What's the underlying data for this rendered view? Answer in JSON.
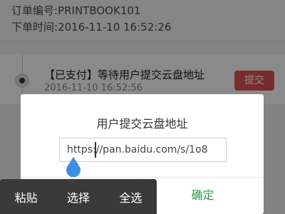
{
  "order": {
    "number_label": "订单编号:",
    "number": "PRINTBOOK101",
    "time_label": "下单时间:",
    "time": "2016-11-10 16:52:26"
  },
  "timeline": {
    "status_title": "【已支付】等待用户提交云盘地址",
    "status_time": "2016-11-10 16:52:56",
    "submit_label": "提交"
  },
  "dialog": {
    "title": "用户提交云盘地址",
    "input_value": "https://pan.baidu.com/s/1o8",
    "confirm_label": "确定"
  },
  "selection_toolbar": {
    "paste": "粘贴",
    "select": "选择",
    "select_all": "全选"
  },
  "colors": {
    "submit_button": "#d9534f",
    "confirm_text": "#2e9a3e",
    "cursor_handle": "#3d8fe0",
    "toolbar_bg": "#3a3a3a"
  },
  "icons": {
    "timeline_dot": "timeline-dot-icon",
    "text_handle": "text-cursor-handle-icon"
  }
}
